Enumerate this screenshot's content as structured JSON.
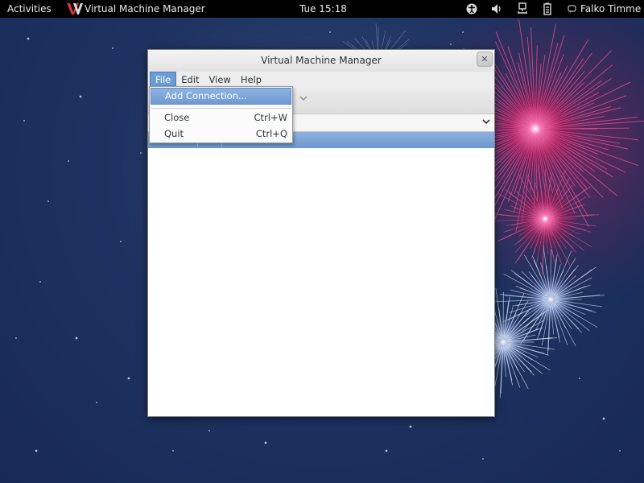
{
  "topbar": {
    "activities": "Activities",
    "app_name": "Virtual Machine Manager",
    "clock": "Tue 15:18",
    "user": "Falko Timme",
    "tray_icons": [
      "accessibility-icon",
      "volume-icon",
      "network-icon",
      "battery-icon"
    ]
  },
  "window": {
    "title": "Virtual Machine Manager",
    "close_glyph": "✕",
    "menubar": [
      "File",
      "Edit",
      "View",
      "Help"
    ],
    "active_menu": "File"
  },
  "file_menu": {
    "items": [
      {
        "label": "Add Connection...",
        "accel": "",
        "highlighted": true
      },
      {
        "label": "Close",
        "accel": "Ctrl+W",
        "highlighted": false
      },
      {
        "label": "Quit",
        "accel": "Ctrl+Q",
        "highlighted": false
      }
    ]
  },
  "colors": {
    "topbar": "#000000",
    "highlight": "#6f9ad2",
    "desktop": "#1e3361",
    "firework_pink": "#e0307a",
    "firework_blue": "#b9cdf2"
  }
}
